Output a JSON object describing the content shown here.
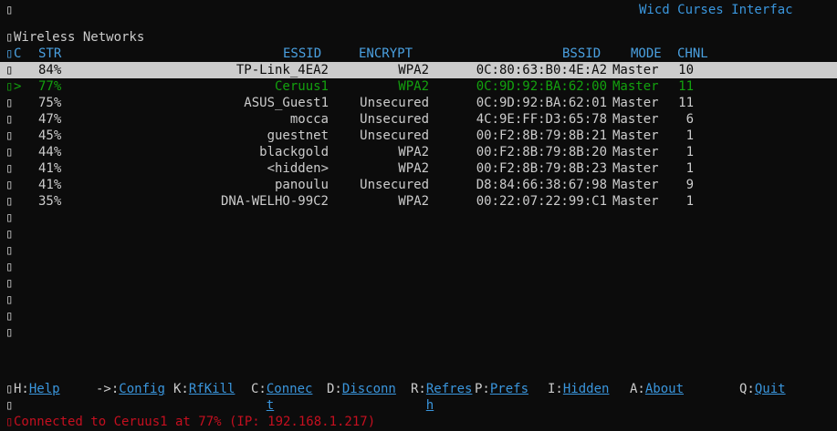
{
  "glyph": "▯",
  "app_title": "Wicd Curses Interfac",
  "section_title": "Wireless Networks",
  "columns": {
    "c": "C",
    "str": "STR",
    "essid": "ESSID",
    "encrypt": "ENCRYPT",
    "bssid": "BSSID",
    "mode": "MODE",
    "chnl": "CHNL"
  },
  "networks": [
    {
      "marker": "",
      "str": "84%",
      "essid": "TP-Link_4EA2",
      "encrypt": "WPA2",
      "bssid": "0C:80:63:B0:4E:A2",
      "mode": "Master",
      "chnl": "10",
      "state": "selected"
    },
    {
      "marker": ">",
      "str": "77%",
      "essid": "Ceruus1",
      "encrypt": "WPA2",
      "bssid": "0C:9D:92:BA:62:00",
      "mode": "Master",
      "chnl": "11",
      "state": "connected"
    },
    {
      "marker": "",
      "str": "75%",
      "essid": "ASUS_Guest1",
      "encrypt": "Unsecured",
      "bssid": "0C:9D:92:BA:62:01",
      "mode": "Master",
      "chnl": "11",
      "state": ""
    },
    {
      "marker": "",
      "str": "47%",
      "essid": "mocca",
      "encrypt": "Unsecured",
      "bssid": "4C:9E:FF:D3:65:78",
      "mode": "Master",
      "chnl": "6",
      "state": ""
    },
    {
      "marker": "",
      "str": "45%",
      "essid": "guestnet",
      "encrypt": "Unsecured",
      "bssid": "00:F2:8B:79:8B:21",
      "mode": "Master",
      "chnl": "1",
      "state": ""
    },
    {
      "marker": "",
      "str": "44%",
      "essid": "blackgold",
      "encrypt": "WPA2",
      "bssid": "00:F2:8B:79:8B:20",
      "mode": "Master",
      "chnl": "1",
      "state": ""
    },
    {
      "marker": "",
      "str": "41%",
      "essid": "<hidden>",
      "encrypt": "WPA2",
      "bssid": "00:F2:8B:79:8B:23",
      "mode": "Master",
      "chnl": "1",
      "state": ""
    },
    {
      "marker": "",
      "str": "41%",
      "essid": "panoulu",
      "encrypt": "Unsecured",
      "bssid": "D8:84:66:38:67:98",
      "mode": "Master",
      "chnl": "9",
      "state": ""
    },
    {
      "marker": "",
      "str": "35%",
      "essid": "DNA-WELHO-99C2",
      "encrypt": "WPA2",
      "bssid": "00:22:07:22:99:C1",
      "mode": "Master",
      "chnl": "1",
      "state": ""
    }
  ],
  "shortcuts": [
    {
      "key": "H:",
      "label": "Help",
      "wrap": ""
    },
    {
      "key": "->:",
      "label": "Config",
      "wrap": ""
    },
    {
      "key": "K:",
      "label": "RfKill",
      "wrap": ""
    },
    {
      "key": "C:",
      "label": "Connec",
      "wrap": "t"
    },
    {
      "key": "D:",
      "label": "Disconn",
      "wrap": ""
    },
    {
      "key": "R:",
      "label": "Refres",
      "wrap": "h"
    },
    {
      "key": "P:",
      "label": "Prefs",
      "wrap": ""
    },
    {
      "key": "I:",
      "label": "Hidden",
      "wrap": ""
    },
    {
      "key": "A:",
      "label": "About",
      "wrap": ""
    },
    {
      "key": "Q:",
      "label": "Quit",
      "wrap": ""
    }
  ],
  "status_text": "Connected to Ceruus1 at 77% (IP: 192.168.1.217)",
  "colors": {
    "background": "#0c0c0c",
    "foreground": "#cccccc",
    "accent_blue": "#3a96dd",
    "connected_green": "#13a10e",
    "status_red": "#c50f1f",
    "selection_bg": "#cccccc"
  }
}
